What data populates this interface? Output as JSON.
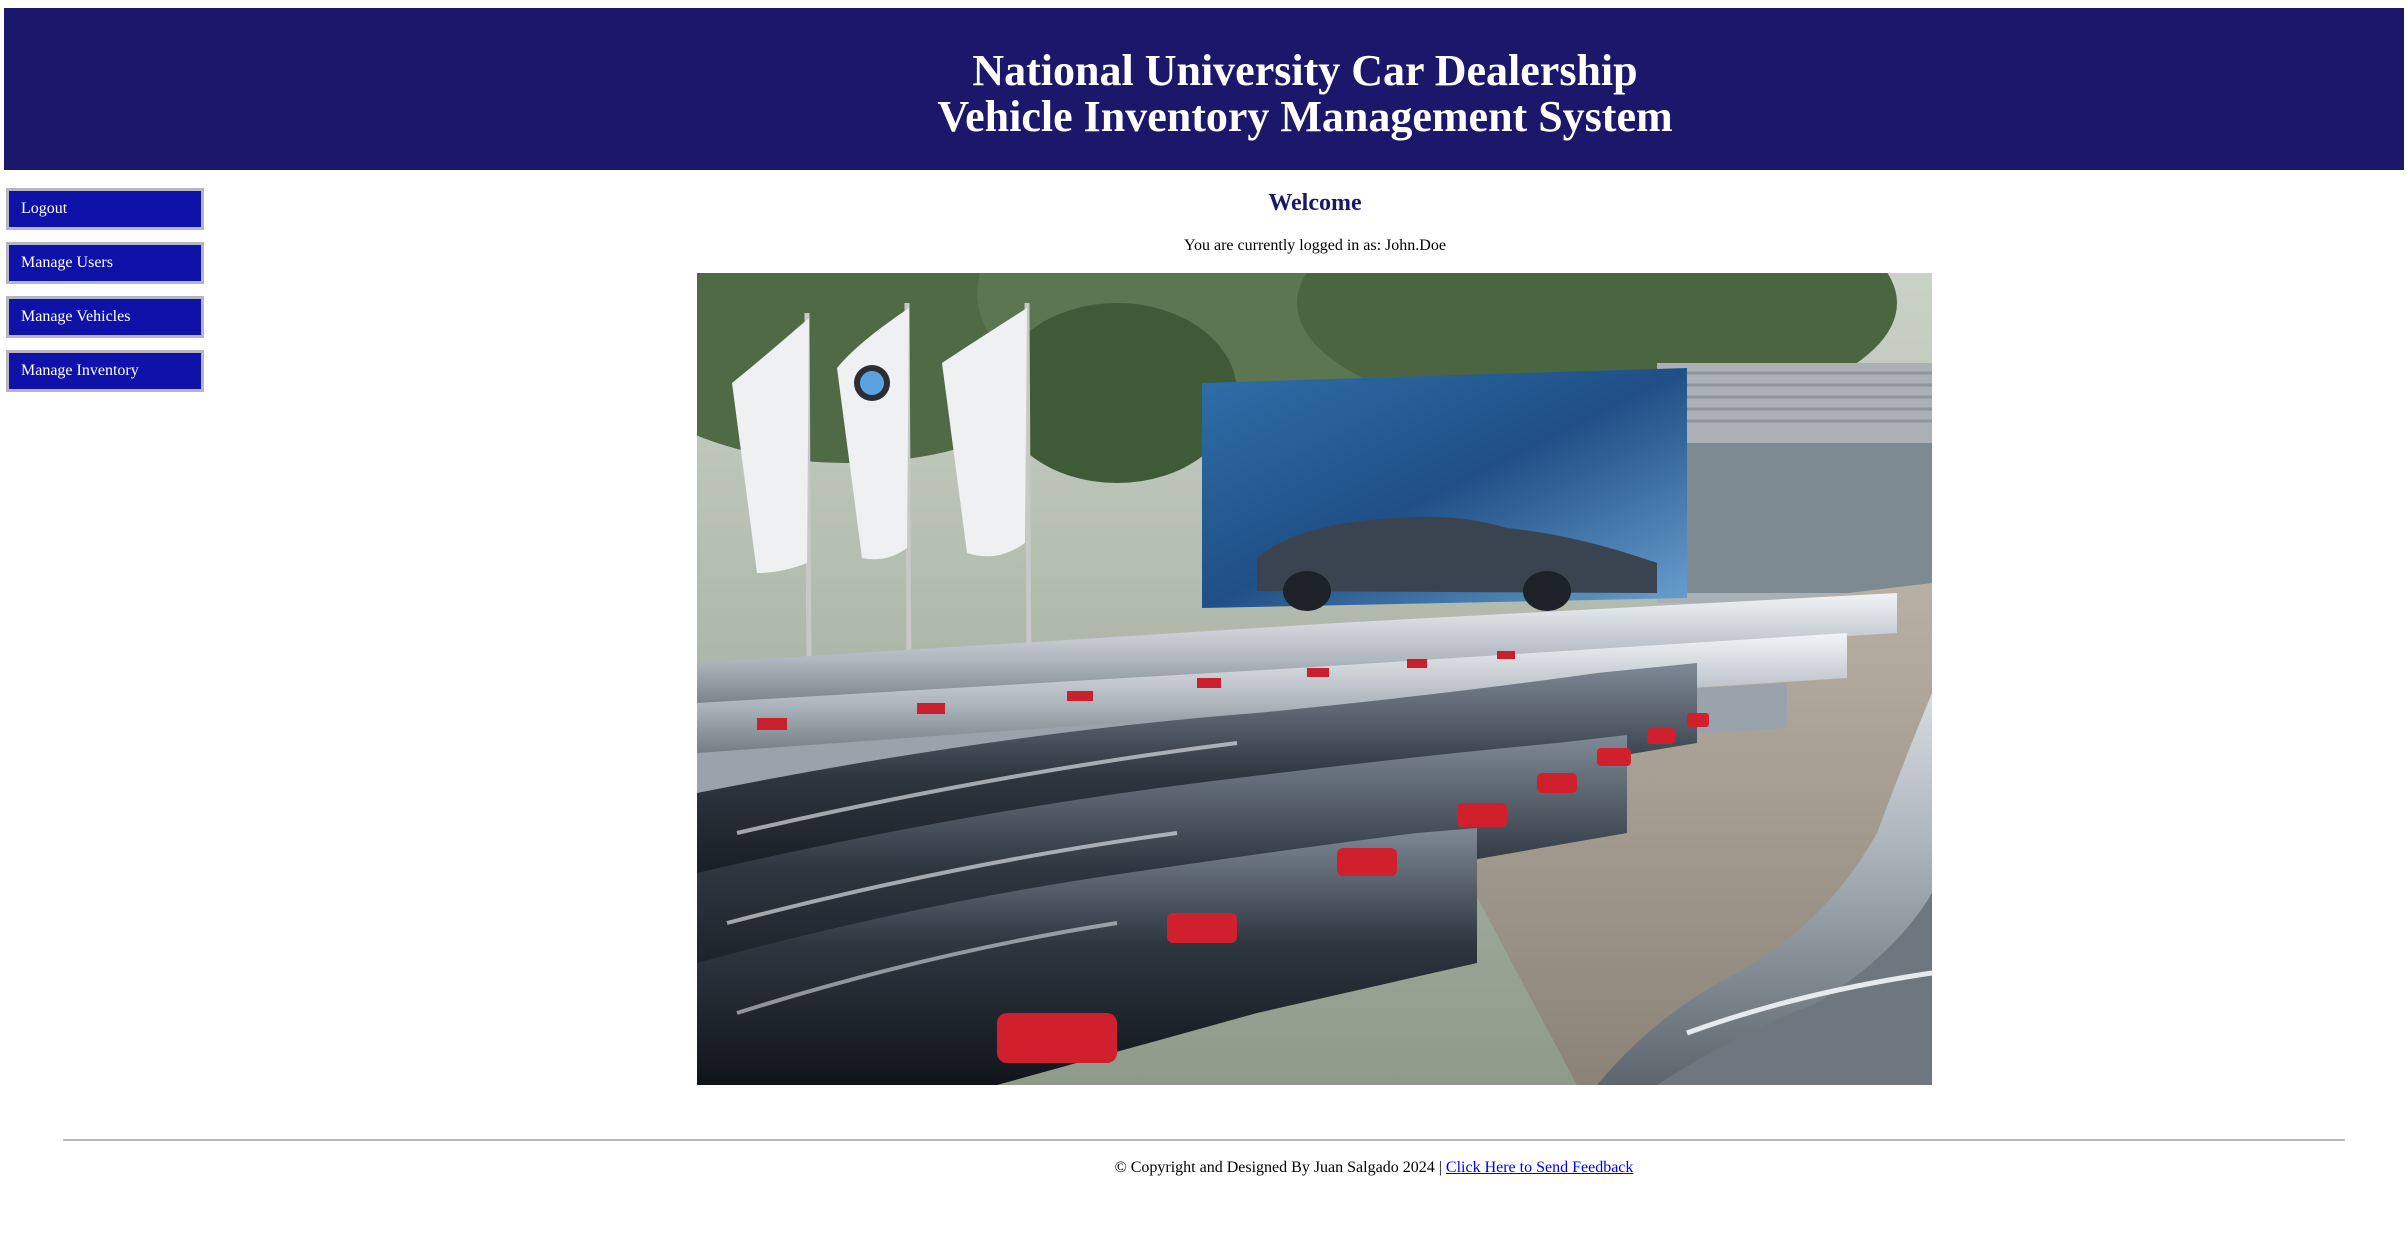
{
  "header": {
    "title": "National University Car Dealership",
    "subtitle": "Vehicle Inventory Management System"
  },
  "sidebar": {
    "items": [
      {
        "label": "Logout"
      },
      {
        "label": "Manage Users"
      },
      {
        "label": "Manage Vehicles"
      },
      {
        "label": "Manage Inventory"
      }
    ]
  },
  "main": {
    "heading": "Welcome",
    "logged_in_text": "You are currently logged in as: John.Doe",
    "hero_image_alt": "Rows of BMW sedans parked at a dealership lot"
  },
  "footer": {
    "copyright": "© Copyright and Designed By Juan Salgado 2024 | ",
    "feedback_link": "Click Here to Send Feedback"
  },
  "colors": {
    "banner": "#1b186b",
    "button": "#0e12a8",
    "heading": "#1b186b",
    "link": "#0000ee"
  }
}
